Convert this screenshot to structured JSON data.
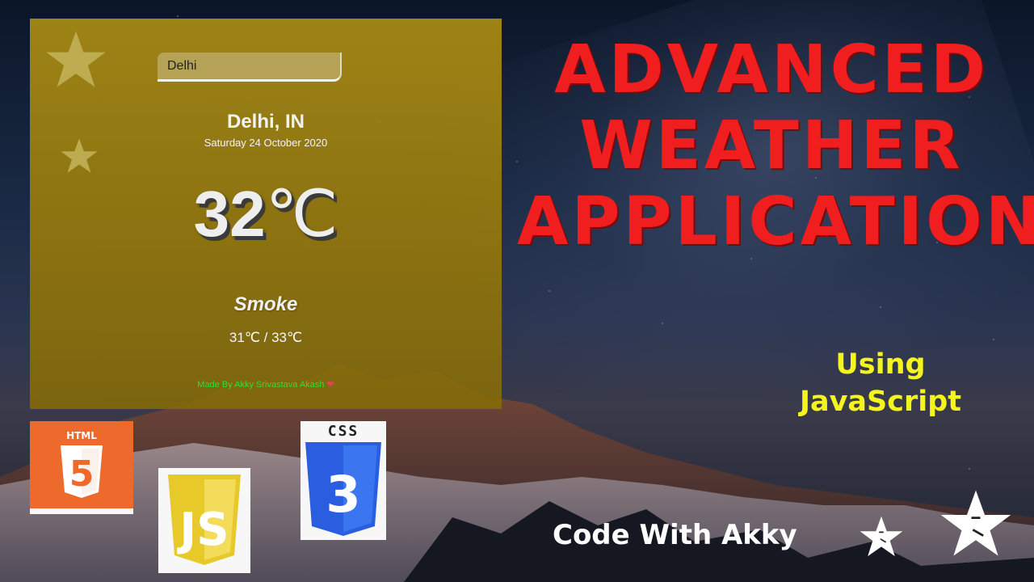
{
  "page": {
    "title_lines": [
      "ADVANCED",
      "WEATHER",
      "APPLICATION"
    ],
    "subtitle_lines": [
      "Using",
      "JavaScript"
    ],
    "brand": "Code With Akky"
  },
  "weather_app": {
    "search_value": "Delhi",
    "city": "Delhi, IN",
    "date": "Saturday 24 October 2020",
    "temp_value": "32",
    "temp_unit": "℃",
    "condition": "Smoke",
    "range": "31℃ / 33℃",
    "credit": "Made By Akky Srivastava Akash",
    "credit_icon": "heart-icon"
  },
  "logos": {
    "html_text": "HTML",
    "html_number": "5",
    "css_text": "CSS",
    "css_number": "3",
    "js_text": "JS"
  },
  "colors": {
    "title": "#f01e1e",
    "subtitle": "#f5f51e",
    "brand": "#ffffff",
    "card": "#a88c14",
    "credit": "#33dd33",
    "html_orange": "#e8642a",
    "css_blue": "#2a5de0",
    "js_yellow": "#e8c92a"
  }
}
